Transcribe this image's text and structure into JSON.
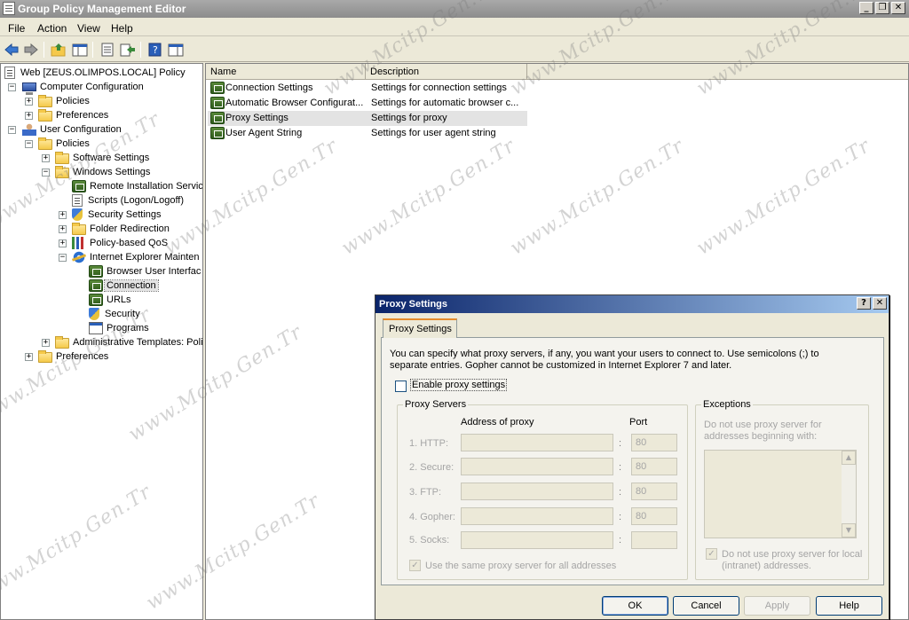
{
  "window": {
    "title": "Group Policy Management Editor"
  },
  "menu": [
    "File",
    "Action",
    "View",
    "Help"
  ],
  "tree": {
    "root": "Web [ZEUS.OLIMPOS.LOCAL] Policy",
    "items": [
      "Computer Configuration",
      "Policies",
      "Preferences",
      "User Configuration",
      "Policies",
      "Software Settings",
      "Windows Settings",
      "Remote Installation Servic",
      "Scripts (Logon/Logoff)",
      "Security Settings",
      "Folder Redirection",
      "Policy-based QoS",
      "Internet Explorer Mainten",
      "Browser User Interfac",
      "Connection",
      "URLs",
      "Security",
      "Programs",
      "Administrative Templates: Poli",
      "Preferences"
    ]
  },
  "list": {
    "columns": [
      "Name",
      "Description"
    ],
    "rows": [
      {
        "name": "Connection Settings",
        "desc": "Settings for connection settings"
      },
      {
        "name": "Automatic Browser Configurat...",
        "desc": "Settings for automatic browser c..."
      },
      {
        "name": "Proxy Settings",
        "desc": "Settings for proxy"
      },
      {
        "name": "User Agent String",
        "desc": "Settings for user agent string"
      }
    ]
  },
  "dialog": {
    "title": "Proxy Settings",
    "help_btn": "?",
    "close_btn": "✕",
    "tab": "Proxy Settings",
    "intro": "You can specify what proxy servers, if any, you want your users to connect to. Use semicolons (;) to separate entries. Gopher cannot be customized in Internet Explorer 7 and later.",
    "enable_label": "Enable proxy settings",
    "proxy_group": "Proxy Servers",
    "address_header": "Address of proxy",
    "port_header": "Port",
    "rows": [
      {
        "label": "1. HTTP:",
        "port": "80"
      },
      {
        "label": "2. Secure:",
        "port": "80"
      },
      {
        "label": "3. FTP:",
        "port": "80"
      },
      {
        "label": "4. Gopher:",
        "port": "80"
      },
      {
        "label": "5. Socks:",
        "port": ""
      }
    ],
    "colon": ":",
    "same_proxy_label": "Use the same proxy server for all addresses",
    "exceptions_group": "Exceptions",
    "exceptions_text": "Do not use proxy server for addresses beginning with:",
    "local_label": "Do not use proxy server for local (intranet) addresses.",
    "buttons": {
      "ok": "OK",
      "cancel": "Cancel",
      "apply": "Apply",
      "help": "Help"
    }
  },
  "watermark": "www.Mcitp.Gen.Tr"
}
